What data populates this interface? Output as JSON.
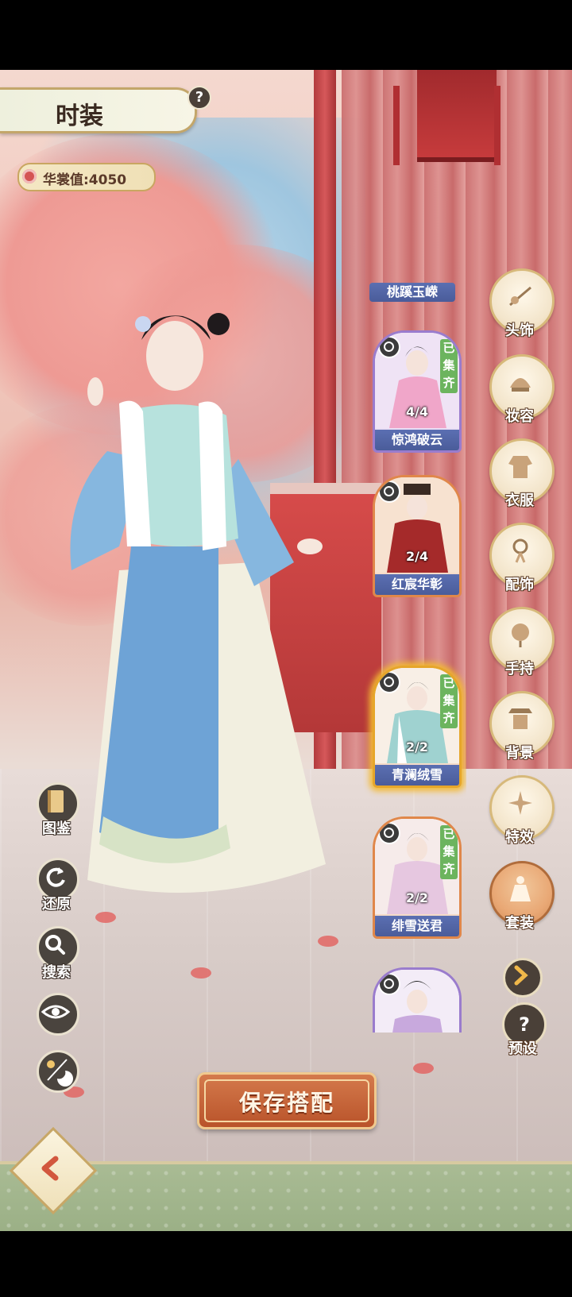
{
  "header": {
    "title": "时装",
    "help": "?"
  },
  "score": {
    "label": "华裳值:4050"
  },
  "outfits": [
    {
      "name": "桃蹊玉嵘"
    },
    {
      "name": "惊鸿破云",
      "count": "4/4",
      "collected": "已集齐"
    },
    {
      "name": "红宸华彰",
      "count": "2/4"
    },
    {
      "name": "青澜绒雪",
      "count": "2/2",
      "collected": "已集齐",
      "selected": true
    },
    {
      "name": "绯雪送君",
      "count": "2/2",
      "collected": "已集齐"
    },
    {
      "name": ""
    }
  ],
  "categories": [
    {
      "label": "头饰",
      "icon": "hairpin-icon"
    },
    {
      "label": "妆容",
      "icon": "headdress-icon"
    },
    {
      "label": "衣服",
      "icon": "robe-icon"
    },
    {
      "label": "配饰",
      "icon": "accessory-icon"
    },
    {
      "label": "手持",
      "icon": "fan-icon"
    },
    {
      "label": "背景",
      "icon": "pavilion-icon"
    },
    {
      "label": "特效",
      "icon": "sparkle-icon"
    },
    {
      "label": "套装",
      "icon": "outfit-set-icon",
      "active": true
    }
  ],
  "preset": {
    "label": "预设"
  },
  "tools": [
    {
      "label": "图鉴",
      "icon": "book-icon"
    },
    {
      "label": "还原",
      "icon": "reset-icon"
    },
    {
      "label": "搜索",
      "icon": "search-icon"
    },
    {
      "label": "",
      "icon": "eye-icon"
    },
    {
      "label": "",
      "icon": "day-night-icon"
    }
  ],
  "save_button": {
    "label": "保存搭配"
  },
  "colors": {
    "accent": "#c0582e",
    "card_name_bg": "#4f61a3",
    "collected_badge": "#6cb45e",
    "selected_glow": "#f2b932"
  }
}
